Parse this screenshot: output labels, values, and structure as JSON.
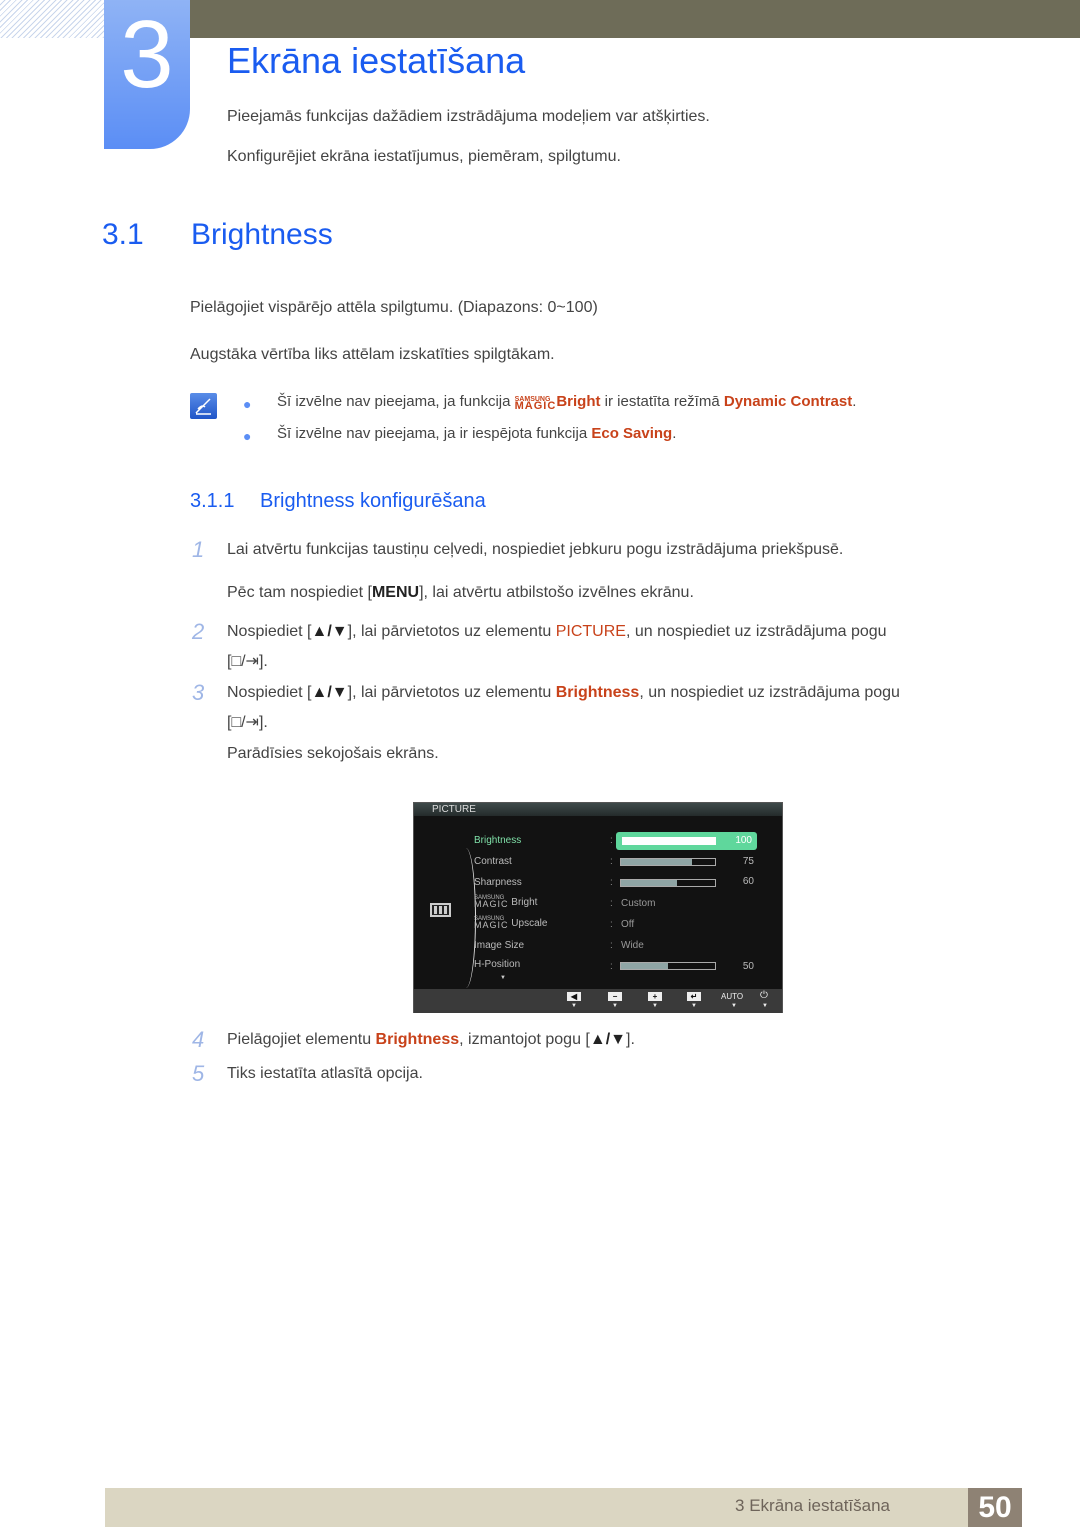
{
  "chapter": {
    "number": "3",
    "title": "Ekrāna iestatīšana",
    "intro": [
      "Pieejamās funkcijas dažādiem izstrādājuma modeļiem var atšķirties.",
      "Konfigurējiet ekrāna iestatījumus, piemēram, spilgtumu."
    ]
  },
  "section": {
    "number": "3.1",
    "title": "Brightness",
    "paragraphs": [
      "Pielāgojiet vispārējo attēla spilgtumu. (Diapazons: 0~100)",
      "Augstāka vērtība liks attēlam izskatīties spilgtākam."
    ],
    "notes": {
      "note1_pre": "Šī izvēlne nav pieejama, ja funkcija ",
      "magic_small": "SAMSUNG",
      "magic_big": "MAGIC",
      "note1_bright": "Bright",
      "note1_mid": " ir iestatīta režīmā ",
      "note1_hl": "Dynamic Contrast",
      "note1_end": ".",
      "note2_pre": "Šī izvēlne nav pieejama, ja ir iespējota funkcija ",
      "note2_hl": "Eco Saving",
      "note2_end": "."
    }
  },
  "subsection": {
    "number": "3.1.1",
    "title": "Brightness konfigurēšana"
  },
  "steps": [
    {
      "num": "1",
      "text": "Lai atvērtu funkcijas taustiņu ceļvedi, nospiediet jebkuru pogu izstrādājuma priekšpusē."
    },
    {
      "num": "",
      "pre": "Pēc tam nospiediet [",
      "btn": "MENU",
      "post": "], lai atvērtu atbilstošo izvēlnes ekrānu."
    },
    {
      "num": "2",
      "pre": "Nospiediet [",
      "btn": "▲/▼",
      "mid": "], lai pārvietotos uz elementu ",
      "hl": "PICTURE",
      "post": ", un nospiediet uz izstrādājuma pogu",
      "line2": "[□/⇥]."
    },
    {
      "num": "3",
      "pre": "Nospiediet [",
      "btn": "▲/▼",
      "mid": "], lai pārvietotos uz elementu ",
      "hl": "Brightness",
      "post": ", un nospiediet uz izstrādājuma pogu",
      "line2": "[□/⇥].",
      "line3": "Parādīsies sekojošais ekrāns."
    },
    {
      "num": "4",
      "pre": "Pielāgojiet elementu ",
      "hl": "Brightness",
      "mid": ", izmantojot pogu [",
      "btn": "▲/▼",
      "post": "]."
    },
    {
      "num": "5",
      "text": "Tiks iestatīta atlasītā opcija."
    }
  ],
  "osd": {
    "header": "PICTURE",
    "items": [
      {
        "label": "Brightness",
        "value": "100",
        "bar": 1.0
      },
      {
        "label": "Contrast",
        "value": "75",
        "bar": 0.75
      },
      {
        "label": "Sharpness",
        "value": "60",
        "bar": 0.6
      },
      {
        "magic_small": "SAMSUNG",
        "magic_big": "MAGIC",
        "label": "Bright",
        "option": "Custom"
      },
      {
        "magic_small": "SAMSUNG",
        "magic_big": "MAGIC",
        "label": "Upscale",
        "option": "Off"
      },
      {
        "label": "Image Size",
        "option": "Wide"
      },
      {
        "label": "H-Position",
        "value": "50",
        "bar": 0.5
      }
    ],
    "buttons": {
      "auto": "AUTO",
      "minus": "−",
      "plus": "+",
      "left": "◀",
      "enter": "↵",
      "power": "⏻"
    }
  },
  "footer": {
    "label": "3 Ekrāna iestatīšana",
    "page": "50"
  }
}
